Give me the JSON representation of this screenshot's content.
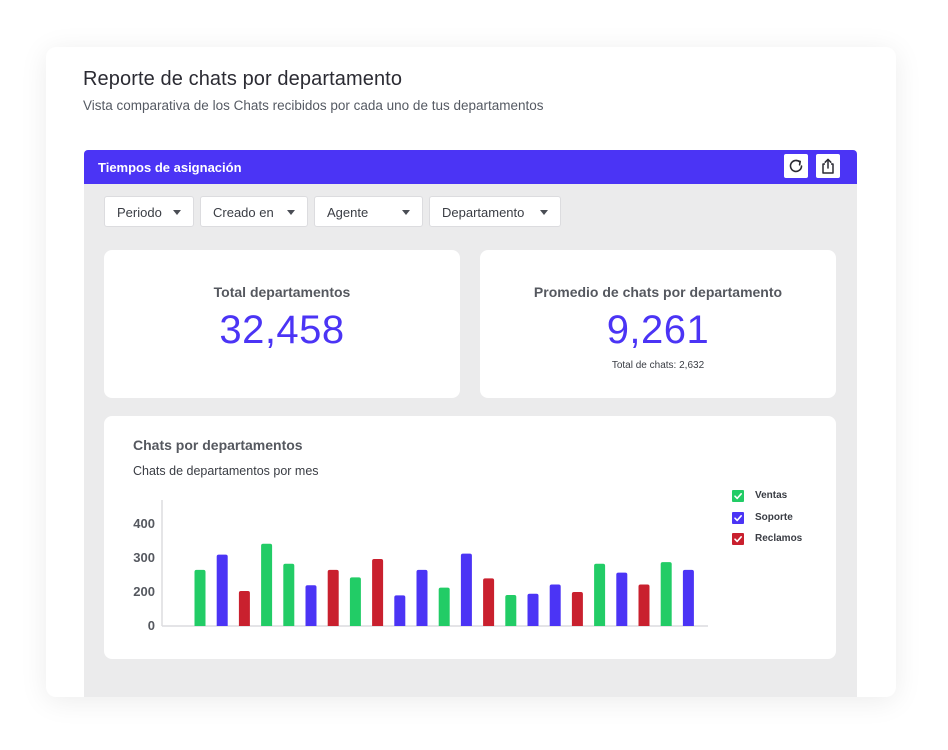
{
  "page": {
    "title": "Reporte de chats por departamento",
    "subtitle": "Vista comparativa de los Chats recibidos por cada uno de tus departamentos"
  },
  "panel": {
    "title": "Tiempos de asignación",
    "refresh_icon": "refresh-icon",
    "share_icon": "share-icon"
  },
  "filters": [
    {
      "label": "Periodo"
    },
    {
      "label": "Creado en"
    },
    {
      "label": "Agente"
    },
    {
      "label": "Departamento"
    }
  ],
  "stats": {
    "total_departments": {
      "label": "Total departamentos",
      "value": "32,458"
    },
    "avg_chats": {
      "label": "Promedio de chats por departamento",
      "value": "9,261",
      "sub": "Total de chats: 2,632"
    }
  },
  "colors": {
    "accent": "#4b34f5",
    "ventas": "#22cc66",
    "soporte": "#4b34f5",
    "reclamos": "#c9202e"
  },
  "chart": {
    "title": "Chats por departamentos",
    "subtitle": "Chats de departamentos por mes"
  },
  "chart_data": {
    "type": "bar",
    "title": "Chats por departamentos",
    "subtitle": "Chats de departamentos por mes",
    "xlabel": "",
    "ylabel": "",
    "ylim": [
      0,
      450
    ],
    "yticks": [
      0,
      200,
      300,
      400
    ],
    "grid": false,
    "legend": "right",
    "series": [
      {
        "name": "Ventas",
        "color": "#22cc66"
      },
      {
        "name": "Soporte",
        "color": "#4b34f5"
      },
      {
        "name": "Reclamos",
        "color": "#c9202e"
      }
    ],
    "bars": [
      {
        "series": "Ventas",
        "value": 265
      },
      {
        "series": "Soporte",
        "value": 310
      },
      {
        "series": "Reclamos",
        "value": 203
      },
      {
        "series": "Ventas",
        "value": 342
      },
      {
        "series": "Ventas",
        "value": 283
      },
      {
        "series": "Soporte",
        "value": 220
      },
      {
        "series": "Reclamos",
        "value": 265
      },
      {
        "series": "Ventas",
        "value": 243
      },
      {
        "series": "Reclamos",
        "value": 297
      },
      {
        "series": "Soporte",
        "value": 180
      },
      {
        "series": "Soporte",
        "value": 265
      },
      {
        "series": "Ventas",
        "value": 213
      },
      {
        "series": "Soporte",
        "value": 313
      },
      {
        "series": "Reclamos",
        "value": 240
      },
      {
        "series": "Ventas",
        "value": 182
      },
      {
        "series": "Soporte",
        "value": 190
      },
      {
        "series": "Soporte",
        "value": 222
      },
      {
        "series": "Reclamos",
        "value": 200
      },
      {
        "series": "Ventas",
        "value": 283
      },
      {
        "series": "Soporte",
        "value": 257
      },
      {
        "series": "Reclamos",
        "value": 222
      },
      {
        "series": "Ventas",
        "value": 288
      },
      {
        "series": "Soporte",
        "value": 265
      }
    ]
  }
}
